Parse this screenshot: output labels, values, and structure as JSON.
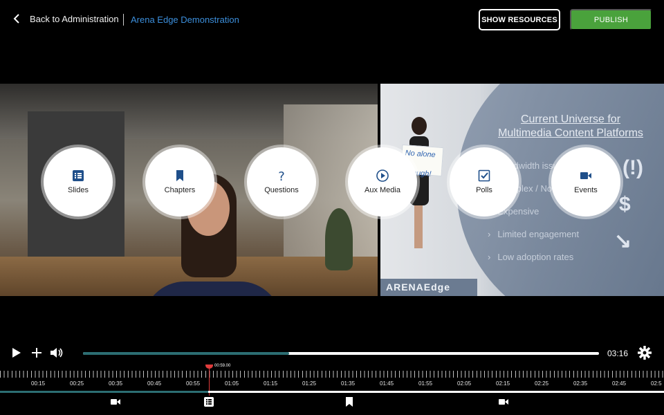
{
  "header": {
    "back_label": "Back to Administration",
    "breadcrumb": "Arena Edge Demonstration",
    "show_resources_label": "SHOW RESOURCES",
    "publish_label": "PUBLISH",
    "publish_color": "#4aa23c",
    "breadcrumb_color": "#3c8fdc"
  },
  "slide": {
    "title_line1": "Current Universe for",
    "title_line2": "Multimedia Content Platforms",
    "bullets": [
      "Bandwidth issues",
      "Complex / Not",
      "Expensive",
      "Limited engagement",
      "Low adoption rates"
    ],
    "sign_text": "No alone is enough!",
    "brand": "ARENAEdge"
  },
  "overlay_menu": [
    {
      "label": "Slides",
      "icon": "slides-list-icon"
    },
    {
      "label": "Chapters",
      "icon": "bookmark-icon"
    },
    {
      "label": "Questions",
      "icon": "question-mark-icon"
    },
    {
      "label": "Aux Media",
      "icon": "play-circle-icon"
    },
    {
      "label": "Polls",
      "icon": "checkbox-icon"
    },
    {
      "label": "Events",
      "icon": "video-camera-icon"
    }
  ],
  "player": {
    "duration": "03:16",
    "progress_fraction": 0.4,
    "playhead_time": "00:59.00",
    "timeline_fill_fraction": 0.314,
    "accent_color": "#2c6e73",
    "playhead_color": "#e03c3c"
  },
  "timeline": {
    "tick_labels": [
      "00:15",
      "00:25",
      "00:35",
      "00:45",
      "00:55",
      "01:05",
      "01:15",
      "01:25",
      "01:35",
      "01:45",
      "01:55",
      "02:05",
      "02:15",
      "02:25",
      "02:35",
      "02:45",
      "02:5"
    ],
    "markers": [
      {
        "icon": "video-camera-icon"
      },
      {
        "icon": "slides-list-icon"
      },
      {
        "icon": "bookmark-icon"
      },
      {
        "icon": "video-camera-icon"
      }
    ]
  }
}
